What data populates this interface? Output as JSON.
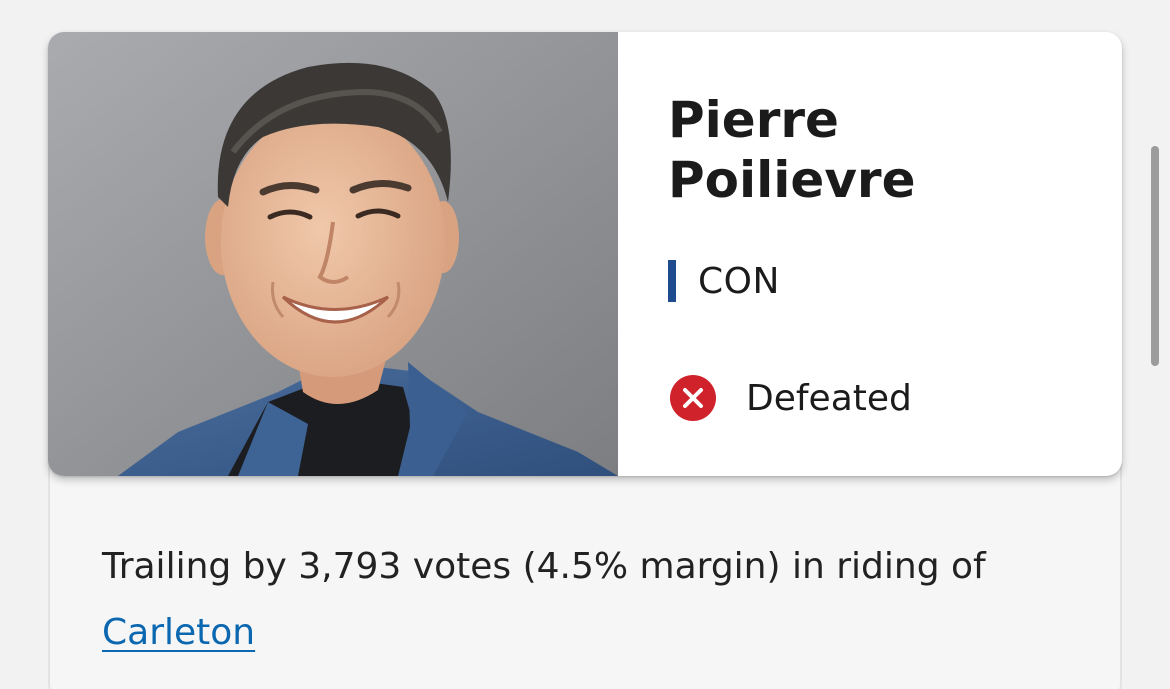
{
  "candidate": {
    "first_name": "Pierre",
    "last_name": "Poilievre",
    "party": "CON",
    "status": "Defeated",
    "photo_icon": "candidate-portrait"
  },
  "summary": {
    "text": "Trailing by 3,793 votes (4.5% margin) in riding of",
    "riding": "Carleton"
  },
  "colors": {
    "party_color": "#1f4c8f",
    "defeated_color": "#d0222b",
    "link_color": "#0b67b0"
  }
}
